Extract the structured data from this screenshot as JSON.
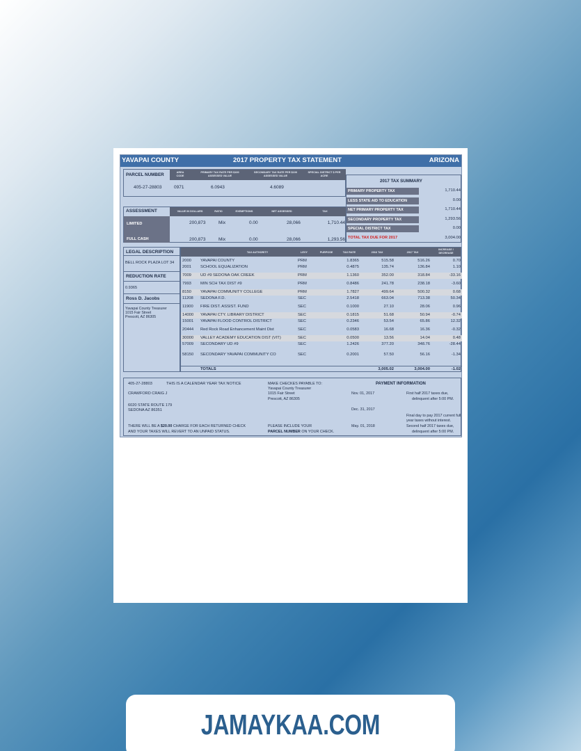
{
  "header": {
    "county": "YAVAPAI COUNTY",
    "title": "2017 PROPERTY TAX STATEMENT",
    "state": "ARIZONA"
  },
  "parcel": {
    "label": "PARCEL NUMBER",
    "col_area": "AREA CODE",
    "col_primary": "PRIMARY TAX RATE PER $100 ASSESSED VALUE",
    "col_secondary": "SECONDARY TAX RATE PER $100 ASSESSED VALUE",
    "col_special": "SPECIAL DISTRICT $ PER ACRE",
    "number": "405-27-28803",
    "area": "0971",
    "primary_rate": "6.0943",
    "secondary_rate": "4.6089"
  },
  "assessment": {
    "label": "ASSESSMENT",
    "cols": [
      "VALUE IN DOLLARS",
      "RATIO",
      "EXEMPTIONS",
      "NET ASSESSED",
      "TAX"
    ],
    "rows": [
      {
        "label": "LIMITED",
        "value": "200,873",
        "ratio": "Mix",
        "exemptions": "0.00",
        "net": "28,066",
        "tax": "1,710.44"
      },
      {
        "label": "FULL CASH",
        "value": "200,873",
        "ratio": "Mix",
        "exemptions": "0.00",
        "net": "28,066",
        "tax": "1,293.56"
      }
    ]
  },
  "summary": {
    "title": "2017 TAX SUMMARY",
    "items": [
      {
        "label": "PRIMARY PROPERTY TAX",
        "value": "1,710.44"
      },
      {
        "label": "LESS STATE AID TO EDUCATION",
        "value": "0.00"
      },
      {
        "label": "NET PRIMARY PROPERTY TAX",
        "value": "1,710.44"
      },
      {
        "label": "SECONDARY PROPERTY TAX",
        "value": "1,293.56"
      },
      {
        "label": "SPECIAL DISTRICT TAX",
        "value": "0.00"
      }
    ],
    "total_label": "TOTAL TAX DUE FOR 2017",
    "total_value": "3,004.00",
    "total_color": "#d21f1f"
  },
  "left_panel": {
    "legal_label": "LEGAL DESCRIPTION",
    "legal_value": "BELL ROCK PLAZA LOT 34",
    "reduction_label": "REDUCTION RATE",
    "reduction_value": "0.9365",
    "name": "Ross D. Jacobs",
    "addr1": "Yavapai County Treasurer",
    "addr2": "1015 Fair Street",
    "addr3": "Prescott, AZ 86305"
  },
  "authority_table": {
    "headers": {
      "authority": "TAX AUTHORITY",
      "levy": "LEVY",
      "purpose": "PURPOSE",
      "rate": "TAX RATE",
      "y2016": "2016 TAX",
      "y2017": "2017 TAX",
      "change": "INCREASE / DECREASE"
    },
    "rows": [
      {
        "code": "2000",
        "name": "YAVAPAI COUNTY",
        "levy": "PRM",
        "rate": "1.8365",
        "t2016": "515.58",
        "t2017": "516.26",
        "change": "0.70"
      },
      {
        "code": "2001",
        "name": "SCHOOL EQUALIZATION",
        "levy": "PRM",
        "rate": "0.4875",
        "t2016": "135.74",
        "t2017": "136.84",
        "change": "1.10"
      },
      {
        "code": "7009",
        "name": "UD #9 SEDONA OAK CREEK",
        "levy": "PRM",
        "rate": "1.1360",
        "t2016": "352.00",
        "t2017": "318.84",
        "change": "-33.16"
      },
      {
        "code": "7993",
        "name": "MIN SCH TAX DIST #9",
        "levy": "PRM",
        "rate": "0.8486",
        "t2016": "241.78",
        "t2017": "238.18",
        "change": "-3.60"
      },
      {
        "code": "8150",
        "name": "YAVAPAI COMMUNITY COLLEGE",
        "levy": "PRM",
        "rate": "1.7827",
        "t2016": "499.64",
        "t2017": "500.32",
        "change": "0.68"
      },
      {
        "code": "11208",
        "name": "SEDONA F.D.",
        "levy": "SEC",
        "rate": "2.5418",
        "t2016": "663.04",
        "t2017": "713.38",
        "change": "50.34"
      },
      {
        "code": "11900",
        "name": "FIRE DIST. ASSIST. FUND",
        "levy": "SEC",
        "rate": "0.1000",
        "t2016": "27.10",
        "t2017": "28.06",
        "change": "0.96"
      },
      {
        "code": "14000",
        "name": "YAVAPAI CTY. LIBRARY DISTRICT",
        "levy": "SEC",
        "rate": "0.1815",
        "t2016": "51.68",
        "t2017": "50.94",
        "change": "-0.74"
      },
      {
        "code": "15001",
        "name": "YAVAPAI FLOOD CONTROL DISTRICT",
        "levy": "SEC",
        "rate": "0.2346",
        "t2016": "53.54",
        "t2017": "65.86",
        "change": "12.32"
      },
      {
        "code": "20444",
        "name": "Red Rock Road Enhancement Maint Dist",
        "levy": "SEC",
        "rate": "0.0583",
        "t2016": "16.68",
        "t2017": "16.36",
        "change": "-0.32"
      },
      {
        "code": "30000",
        "name": "VALLEY ACADEMY EDUCATION DIST (VIT)",
        "levy": "SEC",
        "rate": "0.0500",
        "t2016": "13.56",
        "t2017": "14.04",
        "change": "0.48"
      },
      {
        "code": "57009",
        "name": "SECONDARY UD #9",
        "levy": "SEC",
        "rate": "1.2426",
        "t2016": "377.20",
        "t2017": "348.76",
        "change": "-28.44"
      },
      {
        "code": "58150",
        "name": "SECONDARY YAVAPAI COMMUNITY CO",
        "levy": "SEC",
        "rate": "0.2001",
        "t2016": "57.50",
        "t2017": "56.16",
        "change": "-1.34"
      }
    ],
    "totals": {
      "label": "TOTALS",
      "t2016": "3,005.02",
      "t2017": "3,004.00",
      "change": "-1.02"
    }
  },
  "notice": {
    "parcel": "405-27-28803",
    "calendar": "THIS IS A CALENDAR YEAR TAX NOTICE",
    "owner": "CRAWFORD CRAIG J",
    "addr1": "6020 STATE ROUTE 179",
    "addr2": "SEDONA AZ 86351",
    "charge1_pre": "THERE WILL BE A ",
    "charge1_amt": "$20.00",
    "charge1_post": " CHARGE FOR EACH RETURNED CHECK",
    "charge2": "AND YOUR TAXES WILL REVERT TO AN UNPAID STATUS.",
    "payable_label": "MAKE CHECKES PAYABLE TO:",
    "payable1": "Yavapai County Treasurer",
    "payable2": "1015 Fair Street",
    "payable3": "Prescott, AZ 86305",
    "include1": "PLEASE INCLUDE YOUR",
    "include2_bold": "PARCEL NUMBER",
    "include2_rest": " ON YOUR CHECK.",
    "payment_title": "PAYMENT INFORMATION",
    "p1_date": "Nov. 01, 2017",
    "p1_l1": "First half 2017 taxes due,",
    "p1_l2": "delinquent after 5:00 PM.",
    "p2_date": "Dec. 31, 2017",
    "p2_l1": "Final day to pay 2017 current full",
    "p2_l2": "year taxes without interest.",
    "p3_date": "May. 01, 2018",
    "p3_l1": "Second half 2017 taxes due,",
    "p3_l2": "delinquent after 5:00 PM."
  },
  "watermark": "JAMAYKAA.COM"
}
